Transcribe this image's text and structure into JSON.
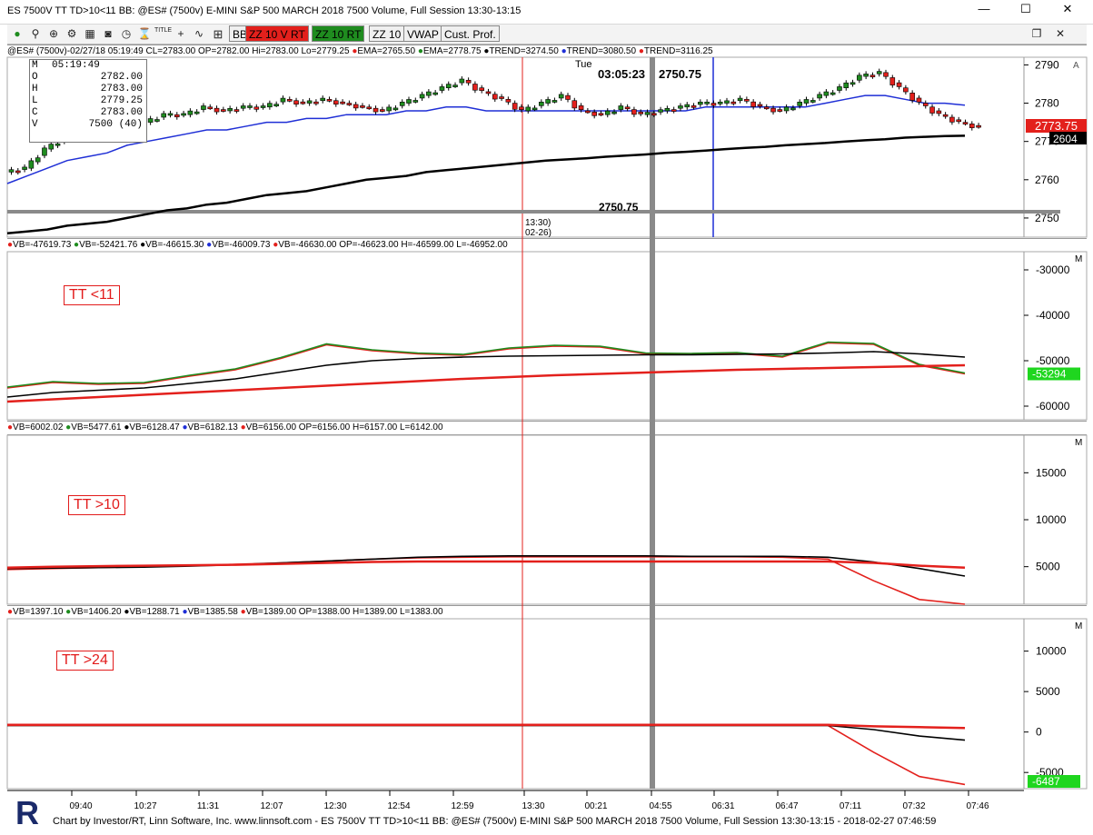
{
  "window": {
    "title": "ES 7500V TT TD>10<11 BB: @ES# (7500v) E-MINI S&P 500 MARCH 2018 7500 Volume, Full Session 13:30-13:15",
    "controls": [
      "—",
      "☐",
      "✕"
    ],
    "restore_label": "❐",
    "close_label": "✕"
  },
  "toolbar": {
    "icons": [
      "dual-dot-icon",
      "magnify-icon",
      "magnify-plus-icon",
      "gear-icon",
      "chart-icon",
      "camera-icon",
      "clock-icon",
      "hourglass-icon",
      "title-icon",
      "crosshair-icon",
      "draw-icon",
      "grid-icon"
    ],
    "title_icon_label": "TITLE",
    "buttons": [
      {
        "label": "BB",
        "bg": "#f0f0f0",
        "fg": "#000000"
      },
      {
        "label": "ZZ 10  V RT",
        "bg": "#e3201c",
        "fg": "#000000"
      },
      {
        "label": "ZZ 10  RT",
        "bg": "#1f8c1f",
        "fg": "#000000"
      },
      {
        "label": "ZZ 10",
        "bg": "#f0f0f0",
        "fg": "#000000"
      },
      {
        "label": "VWAP",
        "bg": "#f0f0f0",
        "fg": "#000000"
      },
      {
        "label": "Cust. Prof.",
        "bg": "#f0f0f0",
        "fg": "#000000"
      }
    ]
  },
  "legends": {
    "price": "@ES# (7500v)-02/27/18 05:19:49 CL=2783.00 OP=2782.00 Hi=2783.00 Lo=2779.25 ●EMA=2765.50 ●EMA=2778.75 ●TREND=3274.50 ●TREND=3080.50 ●TREND=3116.25",
    "pane1": "●VB=-47619.73 ●VB=-52421.76 ●VB=-46615.30 ●VB=-46009.73 ●VB=-46630.00 OP=-46623.00 H=-46599.00 L=-46952.00",
    "pane2": "●VB=6002.02 ●VB=5477.61 ●VB=6128.47 ●VB=6182.13 ●VB=6156.00 OP=6156.00 H=6157.00 L=6142.00",
    "pane3": "●VB=1397.10 ●VB=1406.20 ●VB=1288.71 ●VB=1385.58 ●VB=1389.00 OP=1388.00 H=1389.00 L=1383.00"
  },
  "ohlc_box": {
    "rows": [
      {
        "k": "M",
        "v": "05:19:49"
      },
      {
        "k": "O",
        "v": "2782.00"
      },
      {
        "k": "H",
        "v": "2783.00"
      },
      {
        "k": "L",
        "v": "2779.25"
      },
      {
        "k": "C",
        "v": "2783.00"
      },
      {
        "k": "V",
        "v": "7500 (40)"
      }
    ]
  },
  "annotations": {
    "crosshair_time": "03:05:23",
    "crosshair_price": "2750.75",
    "crosshair_price_lower": "2750.75",
    "day_label": "Tue",
    "session_time": "13:30)",
    "session_date": "02-26)",
    "last_price_tag": "2773.75",
    "ema_tag": "2604",
    "pane1_tag": "-53294",
    "pane3_tag": "-6487",
    "pane_m": "M"
  },
  "pane_labels": [
    "TT <11",
    "TT >10",
    "TT >24"
  ],
  "footer": "Chart by Investor/RT, Linn Software, Inc. www.linnsoft.com - ES 7500V TT TD>10<11 BB: @ES# (7500v) E-MINI S&P 500 MARCH 2018 7500 Volume, Full Session 13:30-13:15 - 2018-02-27 07:46:59",
  "chart_data": [
    {
      "type": "candlestick",
      "ylim": [
        2745,
        2792
      ],
      "yticks": [
        2750,
        2760,
        2770,
        2780,
        2790
      ],
      "x": [
        "09:40",
        "10:27",
        "11:31",
        "12:07",
        "12:30",
        "12:54",
        "12:59",
        "13:30",
        "00:21",
        "04:55",
        "06:31",
        "06:47",
        "07:11",
        "07:32",
        "07:46"
      ],
      "close": [
        2763,
        2768,
        2771,
        2774,
        2771,
        2773,
        2775,
        2777,
        2777,
        2779,
        2778,
        2779,
        2779,
        2781,
        2780,
        2781,
        2780,
        2779,
        2778,
        2780,
        2782,
        2784,
        2786,
        2783,
        2781,
        2778,
        2780,
        2782,
        2778,
        2777,
        2779,
        2777,
        2778,
        2779,
        2780,
        2780,
        2781,
        2779,
        2778,
        2780,
        2782,
        2784,
        2787,
        2788,
        2784,
        2780,
        2777,
        2775,
        2773.75
      ],
      "ema_fast": [
        2759,
        2761,
        2763,
        2765,
        2766,
        2767,
        2769,
        2770,
        2771,
        2772,
        2773,
        2773,
        2774,
        2775,
        2775,
        2776,
        2776,
        2777,
        2777,
        2777,
        2778,
        2778,
        2779,
        2779,
        2778,
        2778,
        2778,
        2778,
        2778,
        2778,
        2778,
        2778,
        2778,
        2778,
        2778,
        2779,
        2779,
        2779,
        2779,
        2779,
        2779,
        2780,
        2781,
        2782,
        2782,
        2781,
        2780,
        2780,
        2779.5
      ],
      "ema_slow": [
        2746,
        2746.5,
        2747,
        2748,
        2748.5,
        2749,
        2750,
        2751,
        2752,
        2752.5,
        2753.5,
        2754,
        2755,
        2756,
        2756.5,
        2757,
        2758,
        2759,
        2760,
        2760.5,
        2761,
        2762,
        2762.5,
        2763,
        2763.5,
        2764,
        2764.5,
        2765,
        2765.3,
        2765.6,
        2766,
        2766.3,
        2766.6,
        2767,
        2767.3,
        2767.6,
        2768,
        2768.3,
        2768.6,
        2769,
        2769.3,
        2769.6,
        2770,
        2770.3,
        2770.6,
        2771,
        2771.2,
        2771.4,
        2771.5
      ],
      "colors": {
        "ema_fast": "#1f2fd6",
        "ema_slow": "#000000",
        "up": "#1f8c1f",
        "down": "#e3201c"
      }
    },
    {
      "type": "line",
      "ylim": [
        -63000,
        -26000
      ],
      "yticks": [
        -30000,
        -40000,
        -50000,
        -60000
      ],
      "series": [
        {
          "color": "#e3201c",
          "values": [
            -56000,
            -54800,
            -55200,
            -55000,
            -53400,
            -52000,
            -49500,
            -46500,
            -47800,
            -48500,
            -48800,
            -47400,
            -46800,
            -47000,
            -48500,
            -48600,
            -48400,
            -49200,
            -46100,
            -46400,
            -51000,
            -52900
          ]
        },
        {
          "color": "#1f8c1f",
          "values": [
            -55800,
            -54600,
            -55000,
            -54800,
            -53200,
            -51800,
            -49300,
            -46300,
            -47600,
            -48300,
            -48600,
            -47200,
            -46600,
            -46800,
            -48300,
            -48400,
            -48200,
            -49000,
            -45900,
            -46200,
            -50800,
            -52700
          ]
        },
        {
          "color": "#000000",
          "values": [
            -58000,
            -57000,
            -56500,
            -56000,
            -55000,
            -54000,
            -52500,
            -51000,
            -50000,
            -49500,
            -49200,
            -49000,
            -48900,
            -48800,
            -48700,
            -48700,
            -48600,
            -48500,
            -48300,
            -48000,
            -48500,
            -49200
          ]
        },
        {
          "color": "#e3201c",
          "values": [
            -59000,
            -58500,
            -58000,
            -57500,
            -57000,
            -56500,
            -56000,
            -55500,
            -55000,
            -54500,
            -54000,
            -53600,
            -53200,
            -52900,
            -52600,
            -52300,
            -52000,
            -51800,
            -51600,
            -51400,
            -51200,
            -51000
          ]
        }
      ]
    },
    {
      "type": "line",
      "ylim": [
        1000,
        19000
      ],
      "yticks": [
        5000,
        10000,
        15000
      ],
      "series": [
        {
          "color": "#e3201c",
          "values": [
            4700,
            4800,
            4900,
            5000,
            5100,
            5250,
            5400,
            5600,
            5800,
            5950,
            6000,
            6050,
            6050,
            6050,
            6050,
            6050,
            6050,
            6000,
            5800,
            3500,
            1500,
            1000
          ]
        },
        {
          "color": "#000000",
          "values": [
            4800,
            4850,
            4900,
            4950,
            5050,
            5200,
            5400,
            5600,
            5800,
            6000,
            6100,
            6150,
            6150,
            6150,
            6150,
            6100,
            6100,
            6100,
            6000,
            5500,
            4800,
            4000
          ]
        },
        {
          "color": "#e3201c",
          "values": [
            4900,
            5000,
            5050,
            5100,
            5150,
            5200,
            5300,
            5400,
            5500,
            5550,
            5550,
            5550,
            5550,
            5550,
            5550,
            5550,
            5550,
            5550,
            5550,
            5400,
            5100,
            4900
          ]
        }
      ]
    },
    {
      "type": "line",
      "ylim": [
        -7000,
        14000
      ],
      "yticks": [
        10000,
        5000,
        0,
        -5000
      ],
      "series": [
        {
          "color": "#e3201c",
          "values": [
            800,
            800,
            800,
            800,
            800,
            800,
            800,
            800,
            800,
            800,
            800,
            800,
            800,
            800,
            800,
            800,
            800,
            800,
            800,
            -2500,
            -5500,
            -6487
          ]
        },
        {
          "color": "#000000",
          "values": [
            800,
            800,
            800,
            800,
            800,
            800,
            800,
            800,
            800,
            800,
            800,
            800,
            800,
            800,
            800,
            800,
            800,
            800,
            800,
            300,
            -500,
            -1000
          ]
        },
        {
          "color": "#e3201c",
          "values": [
            900,
            900,
            900,
            900,
            900,
            900,
            900,
            900,
            900,
            900,
            900,
            900,
            900,
            900,
            900,
            900,
            900,
            900,
            900,
            700,
            600,
            500
          ]
        }
      ]
    }
  ]
}
